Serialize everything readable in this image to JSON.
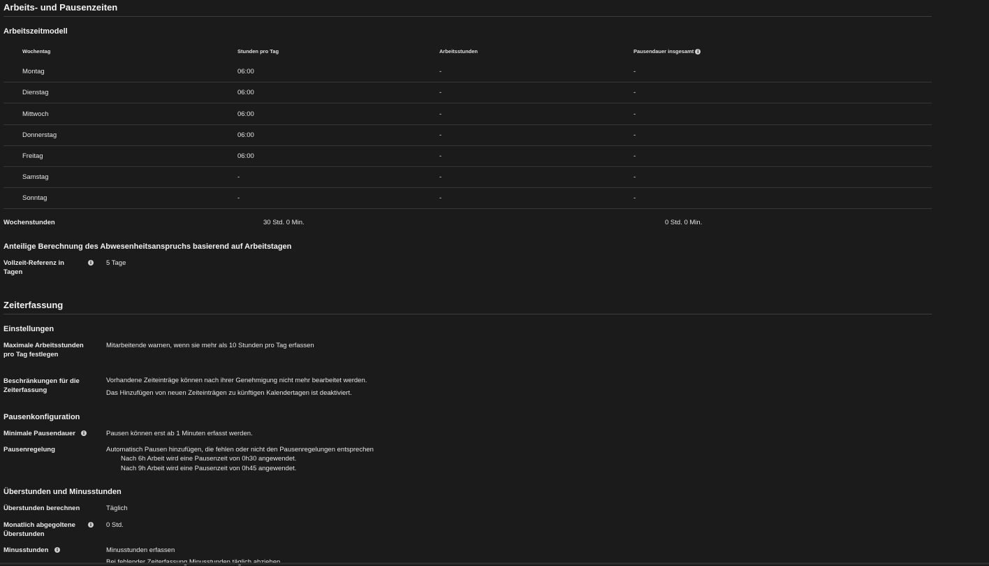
{
  "section_work": {
    "title": "Arbeits- und Pausenzeiten",
    "model_title": "Arbeitszeitmodell",
    "columns": [
      "Wochentag",
      "Stunden pro Tag",
      "Arbeitsstunden",
      "Pausendauer insgesamt"
    ],
    "rows": [
      [
        "Montag",
        "06:00",
        "-",
        "-"
      ],
      [
        "Dienstag",
        "06:00",
        "-",
        "-"
      ],
      [
        "Mittwoch",
        "06:00",
        "-",
        "-"
      ],
      [
        "Donnerstag",
        "06:00",
        "-",
        "-"
      ],
      [
        "Freitag",
        "06:00",
        "-",
        "-"
      ],
      [
        "Samstag",
        "-",
        "-",
        "-"
      ],
      [
        "Sonntag",
        "-",
        "-",
        "-"
      ]
    ],
    "weekly_label": "Wochenstunden",
    "weekly_hours": "30 Std. 0 Min.",
    "weekly_breaks": "0 Std. 0 Min.",
    "proportional_title": "Anteilige Berechnung des Abwesenheitsanspruchs basierend auf Arbeitstagen",
    "fulltime_label": "Vollzeit-Referenz in Tagen",
    "fulltime_value": "5 Tage"
  },
  "section_time": {
    "title": "Zeiterfassung",
    "settings_title": "Einstellungen",
    "max_hours_label": "Maximale Arbeitsstunden pro Tag festlegen",
    "max_hours_value": "Mitarbeitende warnen, wenn sie mehr als 10 Stunden pro Tag erfassen",
    "restrictions_label": "Beschränkungen für die Zeiterfassung",
    "restrictions_line1": "Vorhandene Zeiteinträge können nach ihrer Genehmigung nicht mehr bearbeitet werden.",
    "restrictions_line2": "Das Hinzufügen von neuen Zeiteinträgen zu künftigen Kalendertagen ist deaktiviert.",
    "break_config_title": "Pausenkonfiguration",
    "min_break_label": "Minimale Pausendauer",
    "min_break_value": "Pausen können erst ab 1 Minuten erfasst werden.",
    "break_rule_label": "Pausenregelung",
    "break_rule_value": "Automatisch Pausen hinzufügen, die fehlen oder nicht den Pausenregelungen entsprechen",
    "break_rule_6h": "Nach 6h Arbeit wird eine Pausenzeit von 0h30 angewendet.",
    "break_rule_9h": "Nach 9h Arbeit wird eine Pausenzeit von 0h45 angewendet.",
    "overtime_title": "Überstunden und Minusstunden",
    "overtime_calc_label": "Überstunden berechnen",
    "overtime_calc_value": "Täglich",
    "monthly_label": "Monatlich abgegoltene Überstunden",
    "monthly_value": "0 Std.",
    "minus_label": "Minusstunden",
    "minus_value": "Minusstunden erfassen",
    "minus_sub": "Bei fehlender Zeiterfassung Minusstunden täglich abziehen"
  },
  "icons": {
    "info": "info-icon"
  }
}
